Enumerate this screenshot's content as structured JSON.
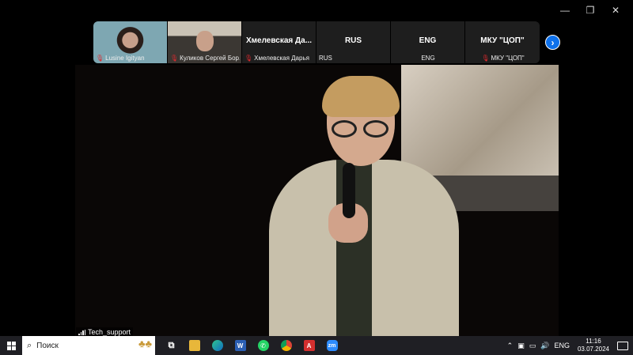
{
  "window": {
    "minimize": "—",
    "restore": "❐",
    "close": "✕"
  },
  "participants": [
    {
      "type": "video",
      "name": "Lusine Igityan",
      "muted": true
    },
    {
      "type": "video",
      "name": "Куликов Сергей Бор...",
      "muted": true
    },
    {
      "type": "text",
      "title": "Хмелевская  Да...",
      "name": "Хмелевская Дарья",
      "muted": true
    },
    {
      "type": "text",
      "title": "RUS",
      "name": "RUS",
      "muted": false
    },
    {
      "type": "text",
      "title": "ENG",
      "name": "ENG",
      "muted": false
    },
    {
      "type": "text",
      "title": "МКУ \"ЦОП\"",
      "name": "МКУ \"ЦОП\"",
      "muted": true
    }
  ],
  "next_icon": "›",
  "main_video": {
    "label": "Tech_support"
  },
  "taskbar": {
    "search_placeholder": "Поиск",
    "apps": [
      "task-view",
      "file-explorer",
      "edge",
      "word",
      "whatsapp",
      "chrome",
      "acrobat",
      "zoom"
    ],
    "tray_lang": "ENG",
    "time": "11:16",
    "date": "03.07.2024"
  },
  "colors": {
    "accent": "#0e71eb",
    "muted": "#e0292e",
    "taskbar": "#1f1f24"
  }
}
